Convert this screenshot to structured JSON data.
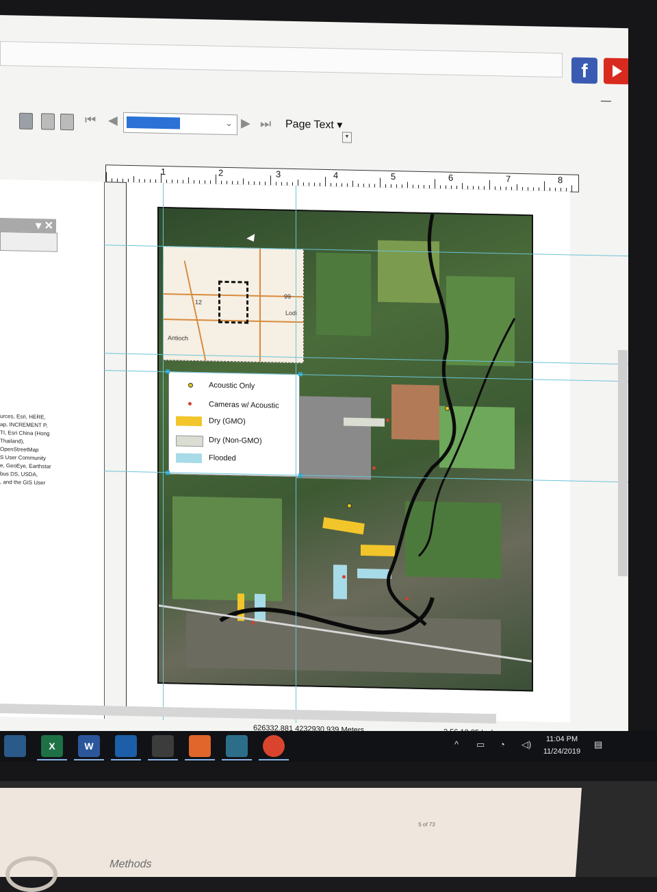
{
  "toolbar": {
    "page_text_label": "Page Text",
    "page_text_caret": "▾"
  },
  "ruler": {
    "labels": [
      "1",
      "2",
      "3",
      "4",
      "5",
      "6",
      "7",
      "8"
    ]
  },
  "left_panel": {
    "credits_text": "urces, Esri, HERE,\nap, INCREMENT P,\nTI, Esri China (Hong\nThailand),\nOpenStreetMap\nS User Community\ne, GeoEye, Earthstar\nbus DS, USDA,\n, and the GIS User"
  },
  "inset_map": {
    "labels": [
      "Antioch",
      "Lodi",
      "12",
      "99"
    ]
  },
  "legend": {
    "items": [
      {
        "label": "Acoustic Only",
        "symbol": "yellow-dot",
        "color": "#e3c81c"
      },
      {
        "label": "Cameras w/ Acoustic",
        "symbol": "red-dot",
        "color": "#d0422e"
      },
      {
        "label": "Dry (GMO)",
        "symbol": "swatch",
        "color": "#f2c52a"
      },
      {
        "label": "Dry (Non-GMO)",
        "symbol": "swatch",
        "color": "#d9ddd2"
      },
      {
        "label": "Flooded",
        "symbol": "swatch",
        "color": "#a8dbe8"
      }
    ]
  },
  "status": {
    "coordinates": "626332.881  4232930.939 Meters",
    "page_position": "2.56  10.05 Inches"
  },
  "taskbar": {
    "apps": [
      {
        "name": "app-1",
        "label": ""
      },
      {
        "name": "excel",
        "label": "X"
      },
      {
        "name": "word",
        "label": "W"
      },
      {
        "name": "app-4",
        "label": ""
      },
      {
        "name": "photos",
        "label": ""
      },
      {
        "name": "app-6",
        "label": ""
      },
      {
        "name": "arcmap",
        "label": ""
      },
      {
        "name": "chrome",
        "label": ""
      }
    ],
    "time": "11:04 PM",
    "date": "11/24/2019"
  },
  "paper": {
    "page_number": "5 of 73",
    "heading": "Methods"
  },
  "colors": {
    "facebook": "#3b5bb3",
    "youtube": "#d92a1f",
    "selection": "#2b71d6",
    "guide": "#6bc3d6"
  }
}
